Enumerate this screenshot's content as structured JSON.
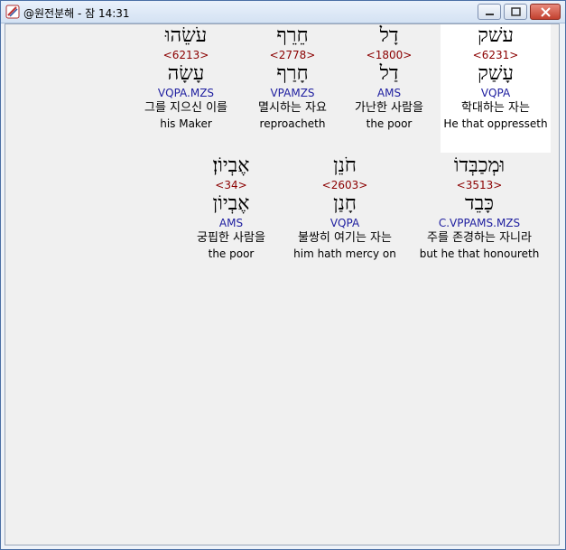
{
  "window": {
    "title": "@원전분해 - 잠 14:31",
    "minimize_label": "",
    "maximize_label": "",
    "close_label": ""
  },
  "rows": [
    {
      "words": [
        {
          "hebrew": "עשׁק",
          "strong": "<6231>",
          "lemma": "עָשַׁק",
          "parse": "VQPA",
          "korean": "학대하는 자는",
          "english": "He that oppresseth",
          "selected": true
        },
        {
          "hebrew": "דָל",
          "strong": "<1800>",
          "lemma": "דַל",
          "parse": "AMS",
          "korean": "가난한 사람을",
          "english": "the poor",
          "selected": false
        },
        {
          "hebrew": "חֵרֵף",
          "strong": "<2778>",
          "lemma": "חָרַף",
          "parse": "VPAMZS",
          "korean": "멸시하는 자요",
          "english": "reproacheth",
          "selected": false
        },
        {
          "hebrew": "עֹשֵׂהוּ",
          "strong": "<6213>",
          "lemma": "עָשָׂה",
          "parse": "VQPA.MZS",
          "korean": "그를 지으신 이를",
          "english": "his Maker",
          "selected": false
        }
      ]
    },
    {
      "words": [
        {
          "hebrew": "וּמְכַבְּדוֹ",
          "strong": "<3513>",
          "lemma": "כָּבֵד",
          "parse": "C.VPPAMS.MZS",
          "korean": "주를 존경하는 자니라",
          "english": "but he that honoureth",
          "selected": false
        },
        {
          "hebrew": "חֹנֵן",
          "strong": "<2603>",
          "lemma": "חָנַן",
          "parse": "VQPA",
          "korean": "불쌍히 여기는 자는",
          "english": "him hath mercy on",
          "selected": false
        },
        {
          "hebrew": "אֶבְיוֹן׃",
          "strong": "<34>",
          "lemma": "אֶבְיוֹן",
          "parse": "AMS",
          "korean": "궁핍한 사람을",
          "english": "the poor",
          "selected": false
        }
      ]
    }
  ]
}
